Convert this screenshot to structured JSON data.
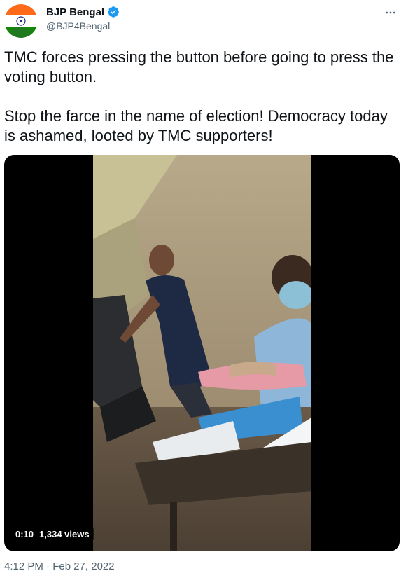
{
  "author": {
    "display_name": "BJP Bengal",
    "handle": "@BJP4Bengal",
    "verified_icon": "verified-badge-icon",
    "avatar_icon": "indian-flag-avatar"
  },
  "tweet": {
    "text": "TMC forces pressing the button before going to press the voting button.\n\nStop the farce in the name of election! Democracy today is ashamed, looted by TMC supporters!",
    "timestamp": "4:12 PM · Feb 27, 2022"
  },
  "media": {
    "type": "video",
    "duration": "0:10",
    "views": "1,334 views"
  },
  "colors": {
    "verified": "#1d9bf0",
    "text_primary": "#0f1419",
    "text_secondary": "#536471"
  },
  "icons": {
    "more": "more-horizontal-icon"
  }
}
